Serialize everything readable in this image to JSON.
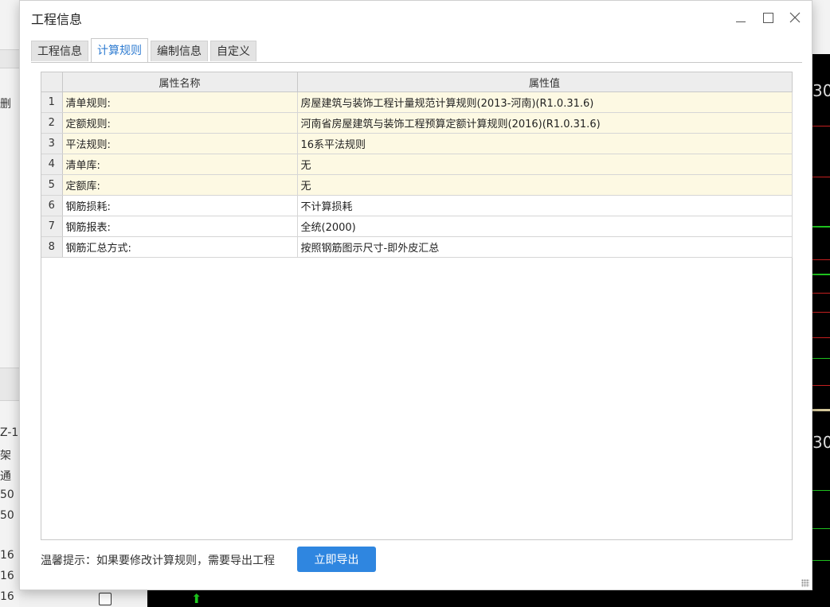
{
  "dialog": {
    "title": "工程信息",
    "tabs": [
      {
        "label": "工程信息",
        "active": false
      },
      {
        "label": "计算规则",
        "active": true
      },
      {
        "label": "编制信息",
        "active": false
      },
      {
        "label": "自定义",
        "active": false
      }
    ],
    "grid": {
      "headers": [
        "属性名称",
        "属性值"
      ],
      "rows": [
        {
          "idx": "1",
          "name": "清单规则:",
          "value": "房屋建筑与装饰工程计量规范计算规则(2013-河南)(R1.0.31.6)",
          "highlight": true
        },
        {
          "idx": "2",
          "name": "定额规则:",
          "value": "河南省房屋建筑与装饰工程预算定额计算规则(2016)(R1.0.31.6)",
          "highlight": true
        },
        {
          "idx": "3",
          "name": "平法规则:",
          "value": "16系平法规则",
          "highlight": true
        },
        {
          "idx": "4",
          "name": "清单库:",
          "value": "无",
          "highlight": true
        },
        {
          "idx": "5",
          "name": "定额库:",
          "value": "无",
          "highlight": true
        },
        {
          "idx": "6",
          "name": "钢筋损耗:",
          "value": "不计算损耗",
          "highlight": false
        },
        {
          "idx": "7",
          "name": "钢筋报表:",
          "value": "全统(2000)",
          "highlight": false
        },
        {
          "idx": "8",
          "name": "钢筋汇总方式:",
          "value": "按照钢筋图示尺寸-即外皮汇总",
          "highlight": false
        }
      ]
    },
    "footer": {
      "tip": "温馨提示：如果要修改计算规则，需要导出工程",
      "export_button": "立即导出"
    }
  },
  "background": {
    "left_texts": [
      "删",
      "Z-1",
      "架",
      "通",
      "50",
      "50",
      "16",
      "16",
      "16"
    ],
    "right_numbers": [
      "30",
      "30"
    ]
  },
  "colors": {
    "accent": "#2f86e0",
    "highlight_row": "#fdf9e3",
    "active_tab_text": "#2f7cd1"
  }
}
